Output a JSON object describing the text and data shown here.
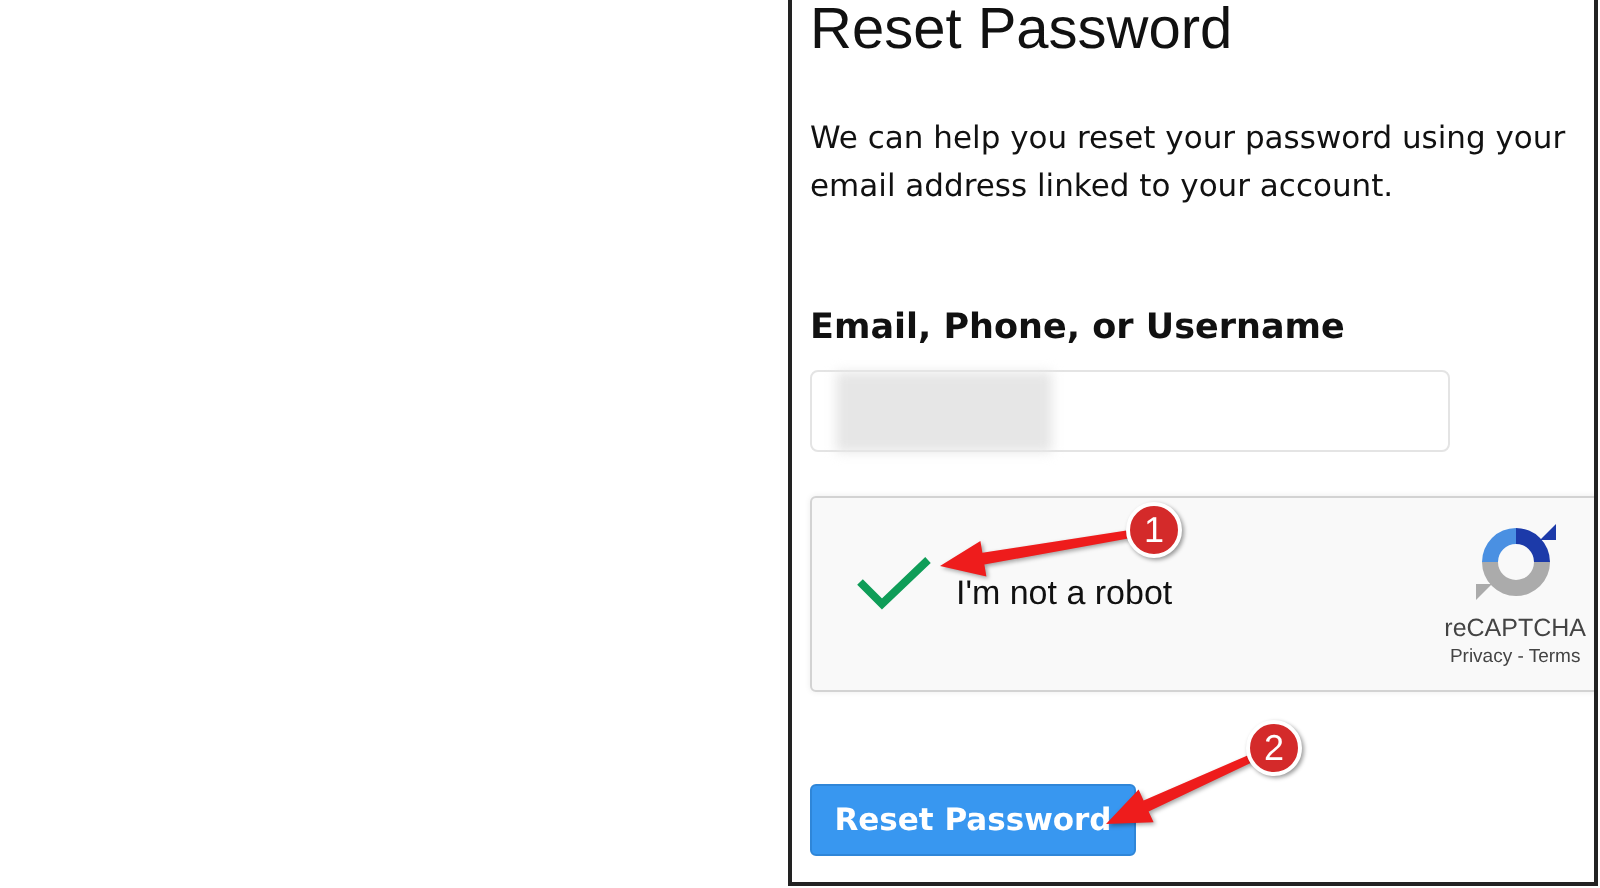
{
  "title": "Reset Password",
  "description": "We can help you reset your password using your email address linked to your account.",
  "field": {
    "label": "Email, Phone, or Username",
    "value": {
      "kind": "redacted"
    }
  },
  "captcha": {
    "checked": true,
    "label": "I'm not a robot",
    "brand": "reCAPTCHA",
    "links": "Privacy - Terms"
  },
  "submit_button": {
    "label": "Reset Password"
  },
  "annotations": [
    {
      "number": "1",
      "kind": "checkbox"
    },
    {
      "number": "2",
      "kind": "button"
    }
  ]
}
